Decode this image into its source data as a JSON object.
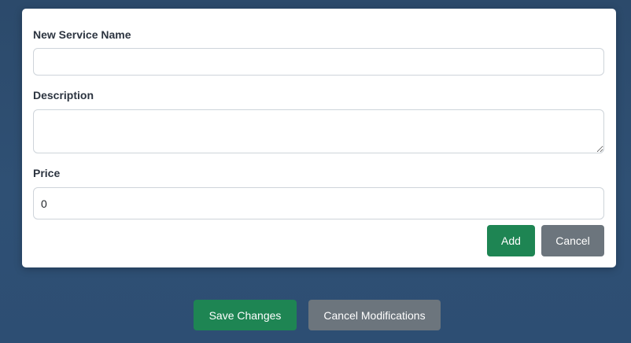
{
  "form": {
    "service_name_label": "New Service Name",
    "service_name_value": "",
    "description_label": "Description",
    "description_value": "",
    "price_label": "Price",
    "price_value": "0",
    "add_label": "Add",
    "cancel_label": "Cancel"
  },
  "footer": {
    "save_label": "Save Changes",
    "cancel_modifications_label": "Cancel Modifications"
  },
  "colors": {
    "background": "#2d4b6e",
    "primary_green": "#1e8553",
    "secondary_gray": "#6c757d",
    "card": "#ffffff"
  }
}
